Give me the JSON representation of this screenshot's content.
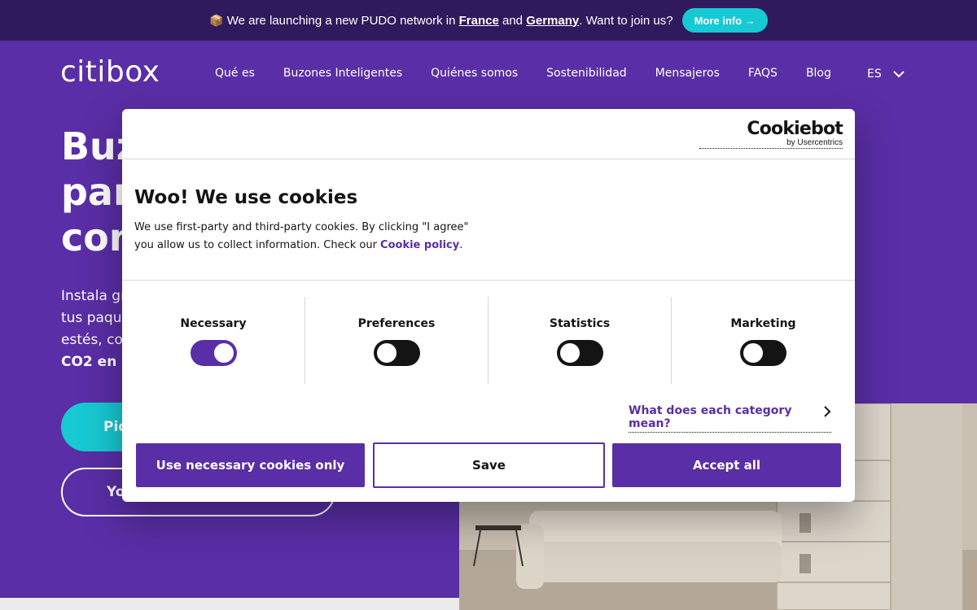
{
  "announcement": {
    "emoji": "📦",
    "text_before": "We are launching a new PUDO network in ",
    "link1": "France",
    "text_mid": " and ",
    "link2": "Germany",
    "text_after": ". Want to join us?",
    "button": "More info →"
  },
  "header": {
    "logo": "citibox",
    "nav": [
      "Qué es",
      "Buzones Inteligentes",
      "Quiénes somos",
      "Sostenibilidad",
      "Mensajeros",
      "FAQS",
      "Blog"
    ],
    "language": "ES"
  },
  "hero": {
    "title_lines": [
      "Buz",
      "par",
      "con"
    ],
    "text_lines": [
      "Instala gra",
      "tus paque",
      "estés, con",
      "CO2 en u"
    ],
    "primary_button": "Pid",
    "secondary_button": "Yo"
  },
  "cookie_dialog": {
    "brand": "Cookiebot",
    "brand_sub": "by Usercentrics",
    "title": "Woo! We use cookies",
    "body_before": "We use first-party and third-party cookies. By clicking \"I agree\" you allow us to collect information. Check our ",
    "body_link": "Cookie policy",
    "body_after": ".",
    "categories": [
      {
        "label": "Necessary",
        "enabled": true
      },
      {
        "label": "Preferences",
        "enabled": false
      },
      {
        "label": "Statistics",
        "enabled": false
      },
      {
        "label": "Marketing",
        "enabled": false
      }
    ],
    "details_link": "What does each category mean?",
    "buttons": {
      "necessary": "Use necessary cookies only",
      "save": "Save",
      "accept": "Accept all"
    }
  },
  "colors": {
    "brand_purple": "#5a2ea6",
    "announce_bg": "#2e1a5c",
    "teal": "#17c9d3"
  }
}
